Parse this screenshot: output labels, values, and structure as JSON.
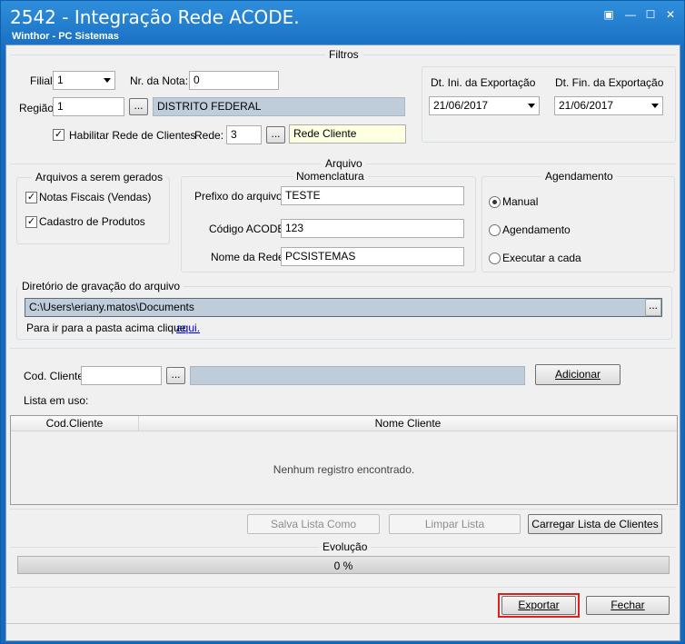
{
  "window": {
    "title": "2542 - Integração Rede ACODE.",
    "subtitle": "Winthor - PC Sistemas",
    "restore_icon": "restore-icon",
    "minimize_icon": "minimize-icon",
    "maximize_icon": "maximize-icon",
    "close_icon": "close-icon"
  },
  "filtros": {
    "legend": "Filtros",
    "filial_label": "Filial",
    "filial_value": "1",
    "nr_nota_label": "Nr. da Nota:",
    "nr_nota_value": "0",
    "regiao_label": "Região",
    "regiao_value": "1",
    "regiao_desc": "DISTRITO FEDERAL",
    "habilitar_label": "Habilitar Rede de Clientes",
    "habilitar_checked": "✓",
    "rede_label": "Rede:",
    "rede_value": "3",
    "rede_desc": "Rede Cliente",
    "browse_label": "...",
    "dt_ini_label": "Dt. Ini. da Exportação",
    "dt_ini_value": "21/06/2017",
    "dt_fin_label": "Dt. Fin. da Exportação",
    "dt_fin_value": "21/06/2017"
  },
  "arquivo": {
    "legend": "Arquivo",
    "gerados_legend": "Arquivos a serem gerados",
    "notas_label": "Notas Fiscais  (Vendas)",
    "notas_checked": "✓",
    "cadastro_label": "Cadastro de Produtos",
    "cadastro_checked": "✓",
    "nomenclatura_legend": "Nomenclatura",
    "prefixo_label": "Prefixo do arquivo:",
    "prefixo_value": "TESTE",
    "codigo_label": "Código ACODE:",
    "codigo_value": "123",
    "nome_rede_label": "Nome da Rede:",
    "nome_rede_value": "PCSISTEMAS",
    "agendamento_legend": "Agendamento",
    "radio_manual": "Manual",
    "radio_agendamento": "Agendamento",
    "radio_executar": "Executar a cada",
    "diretorio_legend": "Diretório de gravação do arquivo",
    "diretorio_value": "C:\\Users\\eriany.matos\\Documents",
    "diretorio_browse": "...",
    "hint_text": "Para ir para a pasta acima clique",
    "hint_link": "aqui."
  },
  "cliente": {
    "cod_label": "Cod. Cliente",
    "cod_value": "",
    "browse_label": "...",
    "desc_value": "",
    "adicionar_label": "Adicionar",
    "lista_label": "Lista em uso:",
    "columns": [
      "Cod.Cliente",
      "Nome Cliente"
    ],
    "empty_text": "Nenhum registro encontrado."
  },
  "buttons": {
    "salva": "Salva Lista Como",
    "limpar": "Limpar Lista",
    "carregar": "Carregar Lista de Clientes",
    "exportar": "Exportar",
    "fechar": "Fechar"
  },
  "evolucao": {
    "legend": "Evolução",
    "progress_text": "0 %",
    "progress": 0
  },
  "colors": {
    "title_bar": "#1669bd",
    "highlight": "#e01f1f",
    "readonly_field": "#bfcddb",
    "link": "#0000cc"
  }
}
